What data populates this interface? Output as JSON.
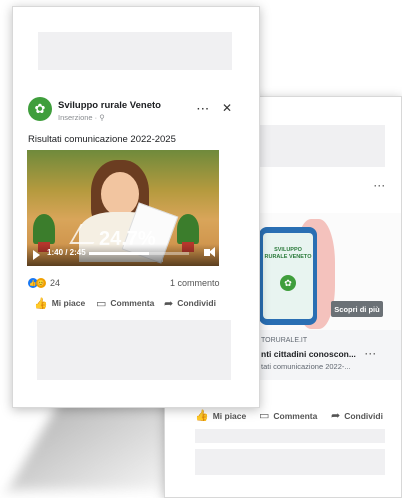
{
  "front_post": {
    "page_name": "Sviluppo rurale Veneto",
    "sponsored_label": "Inserzione · ⚲",
    "more_icon": "···",
    "close_icon": "✕",
    "caption": "Risultati comunicazione 2022-2025",
    "video": {
      "overlay_stat": "24,7%",
      "time": "1:40 / 2:45",
      "progress": 0.6
    },
    "reactions_count": "24",
    "comments_count": "1 commento",
    "actions": {
      "like": "Mi piace",
      "comment": "Commenta",
      "share": "Condividi"
    }
  },
  "back_post": {
    "more_icon": "···",
    "phone_title": "SVILUPPO RURALE VENETO",
    "cta_label": "Scopri di più",
    "link_domain": "TORURALE.IT",
    "link_title": "nti cittadini conoscon...",
    "link_subtitle": "tati comunicazione 2022-...",
    "link_more": "···",
    "actions": {
      "like": "Mi piace",
      "comment": "Commenta",
      "share": "Condividi"
    }
  },
  "colors": {
    "brand_green": "#3f9e3c",
    "like_blue": "#1877f2",
    "placeholder_gray": "#f0f0f2"
  }
}
